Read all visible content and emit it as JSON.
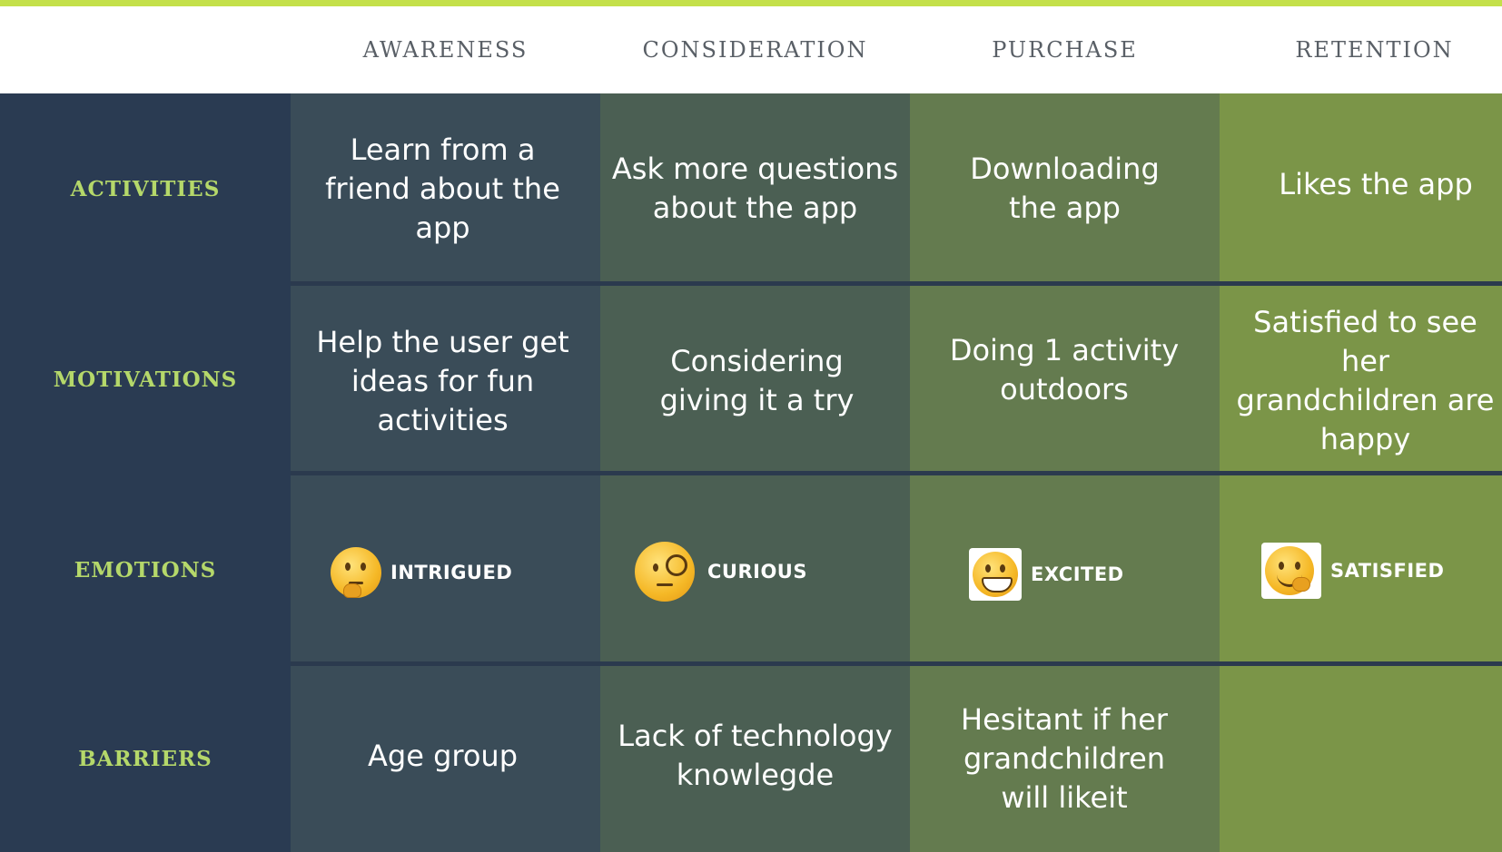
{
  "colors": {
    "top_accent": "#c4e04a",
    "row_header_text": "#b5d86a",
    "column_header_text": "#595f66",
    "awareness_bg": "#3a4c58",
    "consideration_bg": "#4b5f53",
    "purchase_bg": "#647b4f",
    "retention_bg": "#7b9548"
  },
  "columns": [
    "AWARENESS",
    "CONSIDERATION",
    "PURCHASE",
    "RETENTION"
  ],
  "rows": [
    "ACTIVITIES",
    "MOTIVATIONS",
    "EMOTIONS",
    "BARRIERS"
  ],
  "activities": [
    "Learn from a friend about the app",
    "Ask more questions about the app",
    "Downloading the app",
    "Likes the app"
  ],
  "motivations": [
    "Help the user get ideas for fun activities",
    "Considering giving it a try",
    "Doing 1 activity outdoors",
    "Satisfied to see her grandchildren are happy"
  ],
  "emotions": [
    {
      "label": "INTRIGUED",
      "icon": "thinking-face-icon"
    },
    {
      "label": "CURIOUS",
      "icon": "monocle-face-icon"
    },
    {
      "label": "EXCITED",
      "icon": "grinning-face-icon"
    },
    {
      "label": "SATISFIED",
      "icon": "relieved-face-icon"
    }
  ],
  "barriers": [
    "Age group",
    "Lack of technology knowlegde",
    "Hesitant if her grandchildren will likeit",
    ""
  ]
}
